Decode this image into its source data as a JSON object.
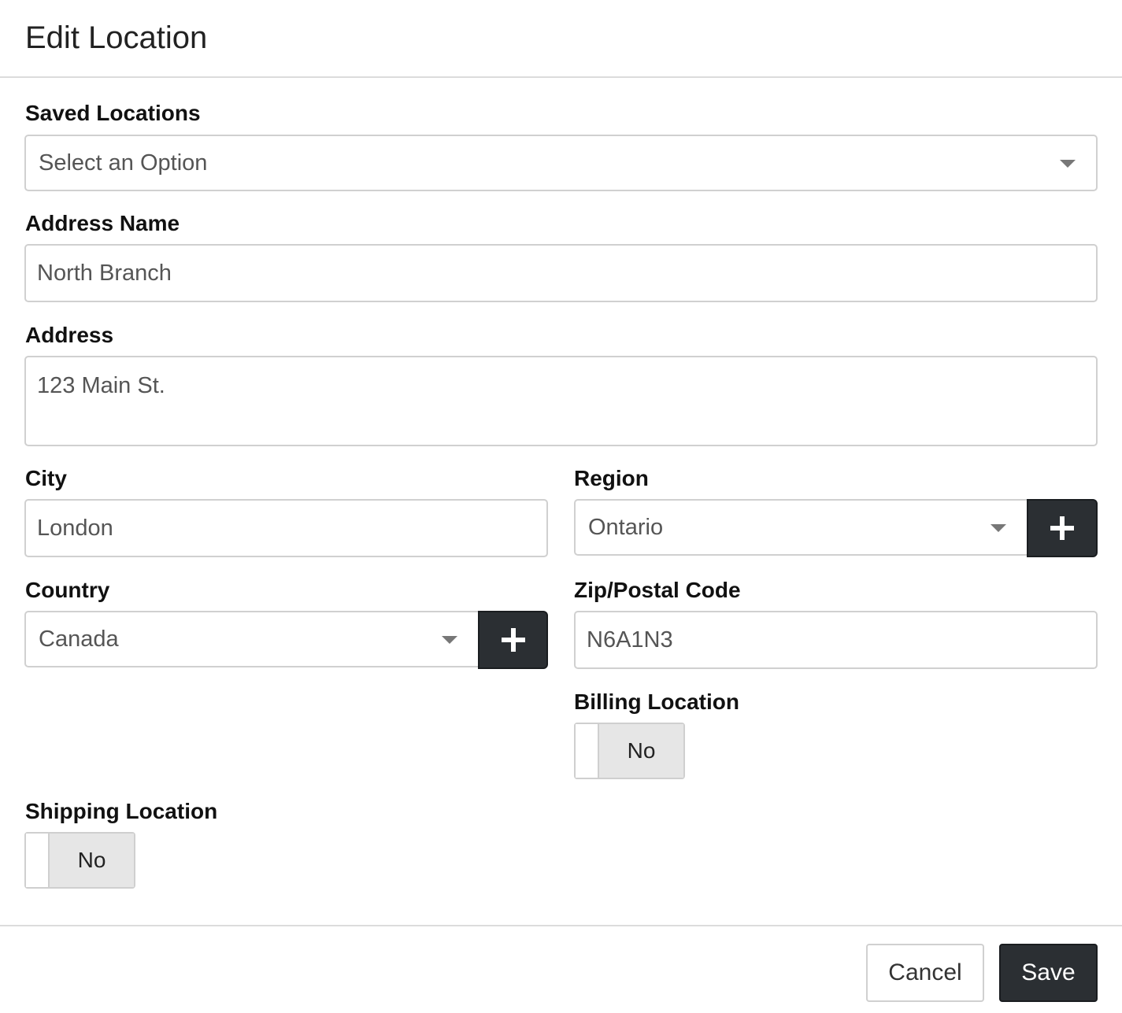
{
  "modal": {
    "title": "Edit Location"
  },
  "form": {
    "saved_locations": {
      "label": "Saved Locations",
      "placeholder": "Select an Option"
    },
    "address_name": {
      "label": "Address Name",
      "value": "North Branch"
    },
    "address": {
      "label": "Address",
      "value": "123 Main St."
    },
    "city": {
      "label": "City",
      "value": "London"
    },
    "region": {
      "label": "Region",
      "value": "Ontario"
    },
    "country": {
      "label": "Country",
      "value": "Canada"
    },
    "postal_code": {
      "label": "Zip/Postal Code",
      "value": "N6A1N3"
    },
    "billing_location": {
      "label": "Billing Location",
      "state": "No"
    },
    "shipping_location": {
      "label": "Shipping Location",
      "state": "No"
    }
  },
  "footer": {
    "cancel_label": "Cancel",
    "save_label": "Save"
  },
  "colors": {
    "primary_button": "#2b2f33",
    "border": "#d0d0d0",
    "toggle_off_bg": "#e6e6e6"
  }
}
